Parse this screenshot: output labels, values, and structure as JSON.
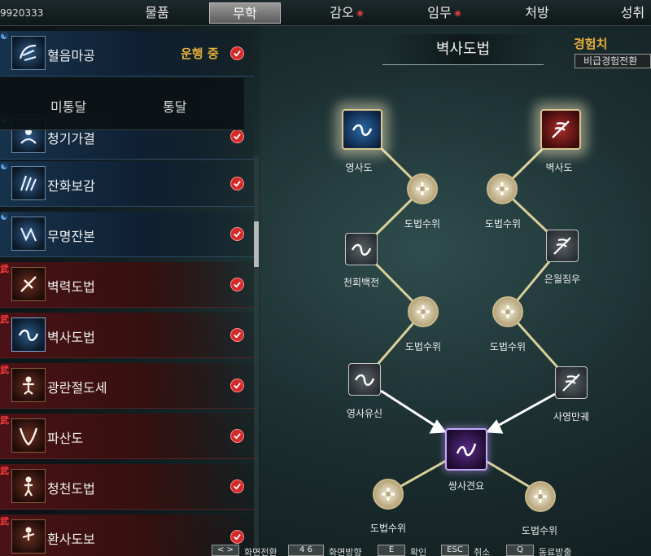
{
  "topbar": {
    "user_id": "9920333",
    "tabs": [
      {
        "label": "물품",
        "dot": false
      },
      {
        "label": "무학",
        "dot": false,
        "active": true
      },
      {
        "label": "감오",
        "dot": true
      },
      {
        "label": "임무",
        "dot": true
      },
      {
        "label": "처방",
        "dot": false
      },
      {
        "label": "성취",
        "dot": false
      }
    ]
  },
  "skill_list": {
    "header": {
      "label": "혈음마공",
      "status": "운행 중"
    },
    "filter_options": [
      "미통달",
      "통달"
    ],
    "items": [
      {
        "label": "청기가결",
        "kind": "blue"
      },
      {
        "label": "잔화보감",
        "kind": "blue"
      },
      {
        "label": "무명잔본",
        "kind": "blue"
      },
      {
        "label": "벽력도법",
        "kind": "red",
        "mark": "武"
      },
      {
        "label": "벽사도법",
        "kind": "red",
        "mark": "武"
      },
      {
        "label": "광란절도세",
        "kind": "red",
        "mark": "武"
      },
      {
        "label": "파산도",
        "kind": "red",
        "mark": "武"
      },
      {
        "label": "청천도법",
        "kind": "red",
        "mark": "武"
      },
      {
        "label": "환사도보",
        "kind": "red",
        "mark": "武"
      }
    ]
  },
  "tree": {
    "title": "벽사도법",
    "exp_label": "경험치",
    "exp_button": "비급경험전환",
    "nodes": {
      "yeongsado": "영사도",
      "byeoksado": "벽사도",
      "mastery_l1": "도법수위",
      "mastery_r1": "도법수위",
      "cheonhoe": "천회백전",
      "eunwol": "은월짐우",
      "mastery_l2": "도법수위",
      "mastery_r2": "도법수위",
      "yeongsayusin": "영사유신",
      "sayeong": "사영만궤",
      "ssangsa": "쌍사견요",
      "mastery_b1": "도법수위",
      "mastery_b2": "도법수위"
    }
  },
  "help": {
    "items": [
      {
        "key": "< >",
        "label": "화면전환"
      },
      {
        "key": "4  6",
        "label": "화면방향"
      },
      {
        "key": "E",
        "label": "확인"
      },
      {
        "key": "ESC",
        "label": "취소"
      },
      {
        "key": "Q",
        "label": "동료방출"
      }
    ]
  },
  "colors": {
    "status_gold": "#e8b13a",
    "check_red": "#d42a2a",
    "tree_line": "#d9cf9a"
  }
}
